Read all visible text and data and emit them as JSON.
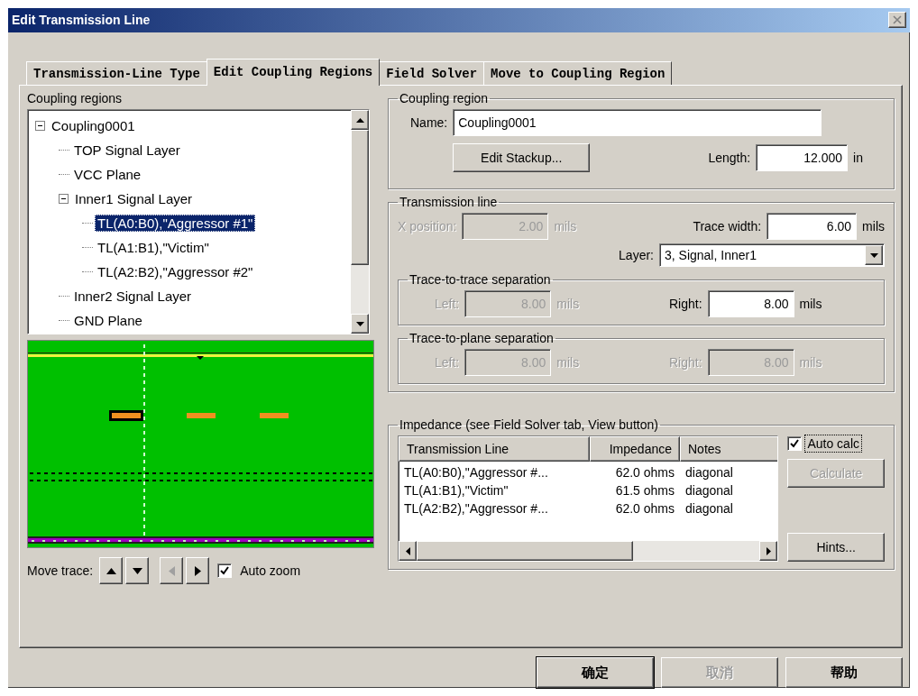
{
  "window": {
    "title": "Edit Transmission Line"
  },
  "tabs": [
    {
      "label": "Transmission-Line Type",
      "selected": false
    },
    {
      "label": "Edit Coupling Regions",
      "selected": true
    },
    {
      "label": "Field Solver",
      "selected": false
    },
    {
      "label": "Move to Coupling Region",
      "selected": false
    }
  ],
  "coupling_regions": {
    "label": "Coupling regions",
    "tree": [
      {
        "label": "Coupling0001",
        "selected": false,
        "expanded": true,
        "children": [
          {
            "label": "TOP Signal Layer",
            "selected": false
          },
          {
            "label": "VCC Plane",
            "selected": false
          },
          {
            "label": "Inner1 Signal Layer",
            "selected": false,
            "expanded": true,
            "children": [
              {
                "label": "TL(A0:B0),\"Aggressor #1\"",
                "selected": true
              },
              {
                "label": "TL(A1:B1),\"Victim\"",
                "selected": false
              },
              {
                "label": "TL(A2:B2),\"Aggressor #2\"",
                "selected": false
              }
            ]
          },
          {
            "label": "Inner2 Signal Layer",
            "selected": false
          },
          {
            "label": "GND Plane",
            "selected": false
          }
        ]
      }
    ]
  },
  "move_trace": {
    "label": "Move trace:",
    "buttons": [
      {
        "kind": "up",
        "disabled": false
      },
      {
        "kind": "down",
        "disabled": false
      },
      {
        "kind": "left",
        "disabled": true
      },
      {
        "kind": "right",
        "disabled": false
      }
    ],
    "auto_zoom": {
      "label": "Auto zoom",
      "checked": true
    }
  },
  "coupling_region": {
    "title": "Coupling region",
    "name": {
      "label": "Name:",
      "value": "Coupling0001"
    },
    "edit_stackup": "Edit Stackup...",
    "length": {
      "label": "Length:",
      "value": "12.000",
      "unit": "in"
    }
  },
  "transmission_line": {
    "title": "Transmission line",
    "x_position": {
      "label": "X position:",
      "value": "2.00",
      "unit": "mils",
      "disabled": true
    },
    "trace_width": {
      "label": "Trace width:",
      "value": "6.00",
      "unit": "mils",
      "disabled": false
    },
    "layer": {
      "label": "Layer:",
      "value": "3, Signal, Inner1"
    },
    "trace_to_trace": {
      "title": "Trace-to-trace separation",
      "left": {
        "label": "Left:",
        "value": "8.00",
        "unit": "mils",
        "disabled": true
      },
      "right": {
        "label": "Right:",
        "value": "8.00",
        "unit": "mils",
        "disabled": false
      }
    },
    "trace_to_plane": {
      "title": "Trace-to-plane separation",
      "left": {
        "label": "Left:",
        "value": "8.00",
        "unit": "mils",
        "disabled": true
      },
      "right": {
        "label": "Right:",
        "value": "8.00",
        "unit": "mils",
        "disabled": true
      }
    }
  },
  "impedance": {
    "title": "Impedance (see Field Solver tab, View button)",
    "table": {
      "columns": [
        "Transmission Line",
        "Impedance",
        "Notes"
      ],
      "rows": [
        [
          "TL(A0:B0),\"Aggressor #...",
          "62.0 ohms",
          "diagonal"
        ],
        [
          "TL(A1:B1),\"Victim\"",
          "61.5 ohms",
          "diagonal"
        ],
        [
          "TL(A2:B2),\"Aggressor #...",
          "62.0 ohms",
          "diagonal"
        ]
      ]
    },
    "auto_calc": {
      "label": "Auto calc",
      "checked": true
    },
    "calculate": {
      "label": "Calculate",
      "disabled": true
    },
    "hints": {
      "label": "Hints...",
      "disabled": false
    }
  },
  "buttons": [
    {
      "label": "确定",
      "disabled": false
    },
    {
      "label": "取消",
      "disabled": true
    },
    {
      "label": "帮助",
      "disabled": false
    }
  ]
}
